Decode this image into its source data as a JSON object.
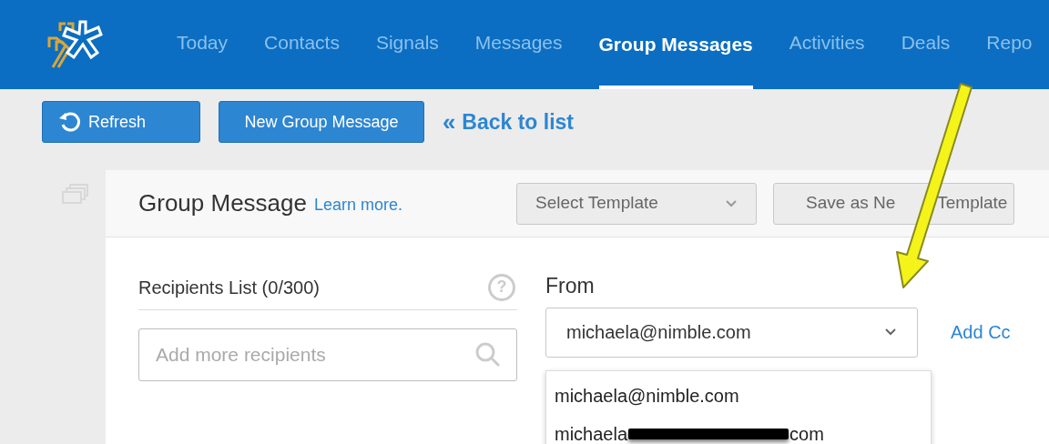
{
  "nav": {
    "items": [
      {
        "label": "Today",
        "selected": false
      },
      {
        "label": "Contacts",
        "selected": false
      },
      {
        "label": "Signals",
        "selected": false
      },
      {
        "label": "Messages",
        "selected": false
      },
      {
        "label": "Group Messages",
        "selected": true
      },
      {
        "label": "Activities",
        "selected": false
      },
      {
        "label": "Deals",
        "selected": false
      },
      {
        "label": "Repo",
        "selected": false
      }
    ]
  },
  "toolbar": {
    "refresh": "Refresh",
    "new_group_message": "New Group Message",
    "back_icon": "‹‹",
    "back": "Back to list"
  },
  "card": {
    "title": "Group Message",
    "learn_more": "Learn more.",
    "template_select": {
      "placeholder": "Select Template"
    },
    "save_template": {
      "start": "Save as Ne",
      "end": "Template"
    },
    "recipients": {
      "label": "Recipients List (0/300)",
      "help": "?",
      "search": {
        "placeholder": "Add more recipients"
      }
    },
    "from": {
      "label": "From",
      "value": "michaela@nimble.com",
      "add_cc": "Add Cc",
      "options": [
        {
          "start": "michaela@nimble.com",
          "redacted": false
        },
        {
          "start": "michaela",
          "redacted": true,
          "end": "com"
        }
      ]
    }
  }
}
